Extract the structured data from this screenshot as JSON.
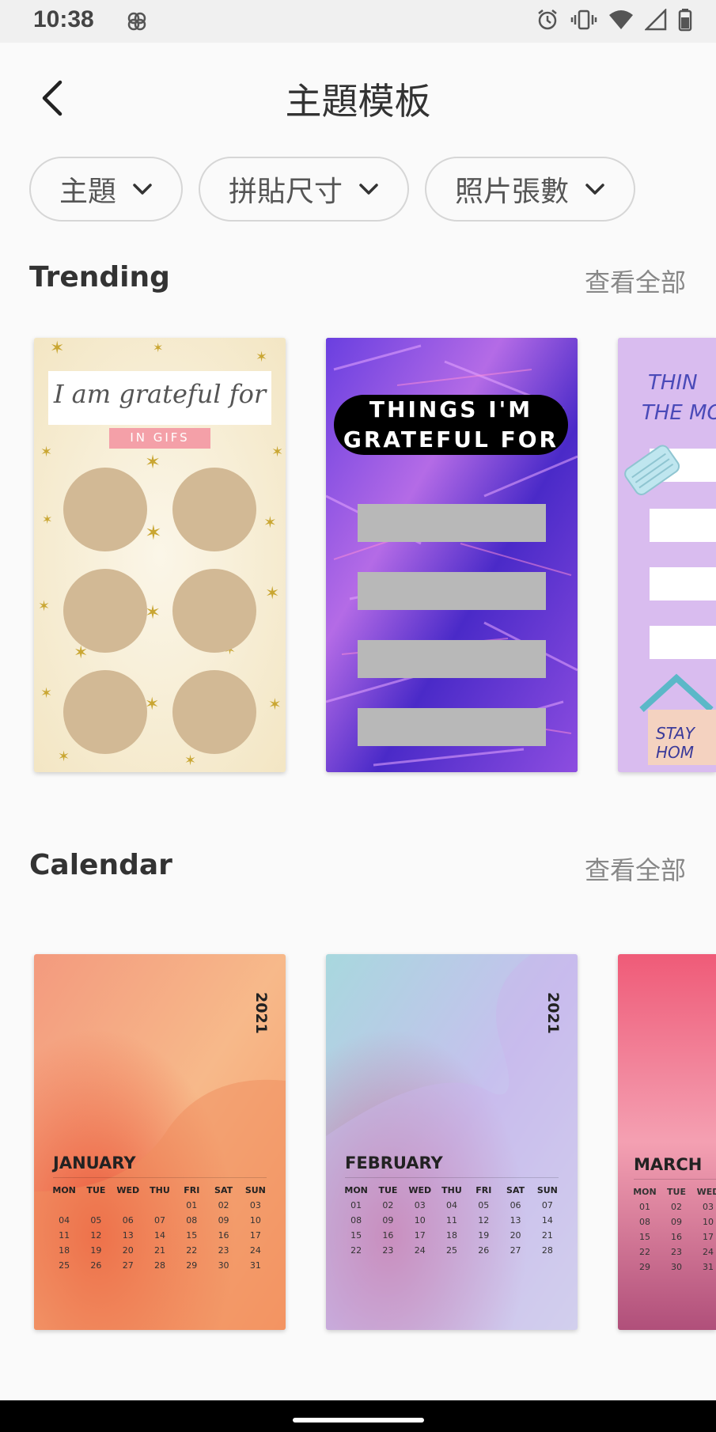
{
  "status": {
    "time": "10:38"
  },
  "header": {
    "title": "主題模板"
  },
  "filters": [
    {
      "label": "主題"
    },
    {
      "label": "拼貼尺寸"
    },
    {
      "label": "照片張數"
    }
  ],
  "sections": {
    "trending": {
      "title": "Trending",
      "see_all": "查看全部"
    },
    "calendar": {
      "title": "Calendar",
      "see_all": "查看全部"
    }
  },
  "trending_cards": [
    {
      "line1": "I am grateful for",
      "line2": "IN GIFS"
    },
    {
      "line1": "THINGS I'M",
      "line2": "GRATEFUL FOR"
    },
    {
      "line1": "THIN",
      "line2": "THE MO",
      "sticker": "STAY HOM"
    }
  ],
  "calendar_cards": [
    {
      "year": "2021",
      "month": "JANUARY",
      "weekdays": [
        "MON",
        "TUE",
        "WED",
        "THU",
        "FRI",
        "SAT",
        "SUN"
      ],
      "days": [
        "",
        "",
        "",
        "",
        "01",
        "02",
        "03",
        "04",
        "05",
        "06",
        "07",
        "08",
        "09",
        "10",
        "11",
        "12",
        "13",
        "14",
        "15",
        "16",
        "17",
        "18",
        "19",
        "20",
        "21",
        "22",
        "23",
        "24",
        "25",
        "26",
        "27",
        "28",
        "29",
        "30",
        "31"
      ]
    },
    {
      "year": "2021",
      "month": "FEBRUARY",
      "weekdays": [
        "MON",
        "TUE",
        "WED",
        "THU",
        "FRI",
        "SAT",
        "SUN"
      ],
      "days": [
        "01",
        "02",
        "03",
        "04",
        "05",
        "06",
        "07",
        "08",
        "09",
        "10",
        "11",
        "12",
        "13",
        "14",
        "15",
        "16",
        "17",
        "18",
        "19",
        "20",
        "21",
        "22",
        "23",
        "24",
        "25",
        "26",
        "27",
        "28"
      ]
    },
    {
      "month": "MARCH",
      "weekdays": [
        "MON",
        "TUE",
        "WED"
      ],
      "days": [
        "01",
        "02",
        "03",
        "08",
        "09",
        "10",
        "15",
        "16",
        "17",
        "22",
        "23",
        "24",
        "29",
        "30",
        "31"
      ]
    }
  ],
  "colors": {
    "accent_text": "#333333",
    "muted": "#888888",
    "chip_border": "#d6d6d6"
  }
}
